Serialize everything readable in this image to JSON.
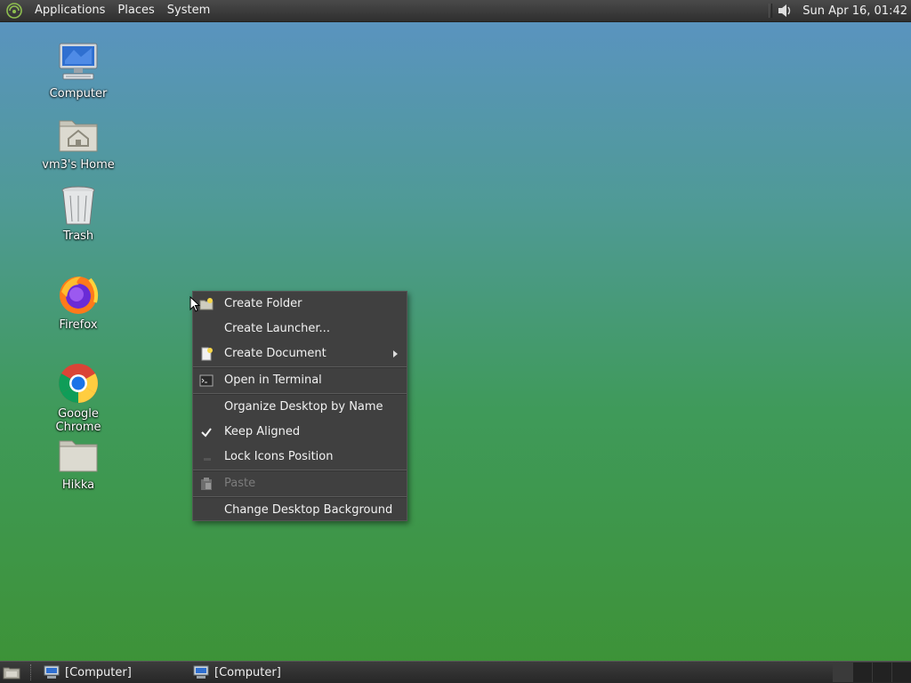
{
  "top_panel": {
    "menus": [
      "Applications",
      "Places",
      "System"
    ],
    "clock": "Sun Apr 16, 01:42"
  },
  "desktop_icons": [
    {
      "label": "Computer"
    },
    {
      "label": "vm3's Home"
    },
    {
      "label": "Trash"
    },
    {
      "label": "Firefox"
    },
    {
      "label": "Google Chrome"
    },
    {
      "label": "Hikka"
    }
  ],
  "context_menu": {
    "items": [
      {
        "label": "Create Folder",
        "icon": "folder-new-icon"
      },
      {
        "label": "Create Launcher..."
      },
      {
        "label": "Create Document",
        "icon": "document-new-icon",
        "submenu": true
      },
      {
        "label": "Open in Terminal",
        "icon": "terminal-icon"
      },
      {
        "label": "Organize Desktop by Name"
      },
      {
        "label": "Keep Aligned",
        "checked": true
      },
      {
        "label": "Lock Icons Position",
        "checked": false
      },
      {
        "label": "Paste",
        "icon": "paste-icon",
        "disabled": true
      },
      {
        "label": "Change Desktop Background"
      }
    ]
  },
  "bottom_panel": {
    "tasks": [
      {
        "label": "[Computer]"
      },
      {
        "label": "[Computer]"
      }
    ]
  },
  "colors": {
    "panel": "#2f2f2f",
    "menu_bg": "#404040",
    "disabled_text": "#7c7c7c",
    "desktop_top": "#5b93c4",
    "desktop_bottom": "#3d9235"
  }
}
